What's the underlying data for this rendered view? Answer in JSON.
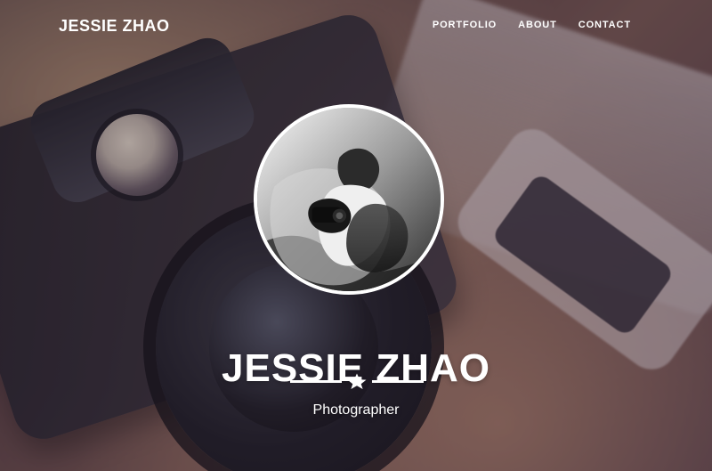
{
  "nav": {
    "brand": "JESSIE ZHAO",
    "links": [
      {
        "label": "PORTFOLIO"
      },
      {
        "label": "ABOUT"
      },
      {
        "label": "CONTACT"
      }
    ]
  },
  "hero": {
    "name": "JESSIE ZHAO",
    "subtitle": "Photographer"
  },
  "icons": {
    "divider": "star-icon"
  },
  "colors": {
    "text": "#ffffff"
  }
}
